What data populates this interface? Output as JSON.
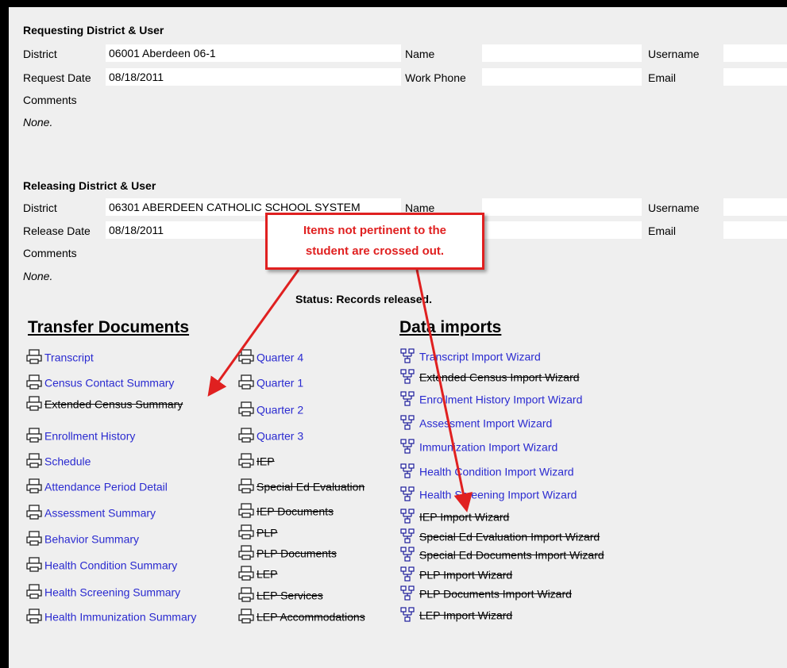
{
  "requesting": {
    "title": "Requesting District & User",
    "district_label": "District",
    "district_value": "06001 Aberdeen 06-1",
    "name_label": "Name",
    "name_value": "",
    "username_label": "Username",
    "username_value": "",
    "request_date_label": "Request Date",
    "request_date_value": "08/18/2011",
    "work_phone_label": "Work Phone",
    "work_phone_value": "",
    "email_label": "Email",
    "email_value": "",
    "comments_label": "Comments",
    "comments_value": "None."
  },
  "releasing": {
    "title": "Releasing District & User",
    "district_label": "District",
    "district_value": "06301 ABERDEEN CATHOLIC SCHOOL SYSTEM",
    "name_label": "Name",
    "name_value": "",
    "username_label": "Username",
    "username_value": "",
    "release_date_label": "Release Date",
    "release_date_value": "08/18/2011",
    "email_label": "Email",
    "email_value": "",
    "comments_label": "Comments",
    "comments_value": "None."
  },
  "status": "Status: Records released.",
  "callout": {
    "line1": "Items not pertinent to the",
    "line2": "student are crossed out.",
    "color": "#e02020"
  },
  "transfer_documents": {
    "title": "Transfer Documents",
    "col1": [
      {
        "label": "Transcript",
        "crossed": false,
        "icon": "printer-icon"
      },
      {
        "label": "Census Contact Summary",
        "crossed": false,
        "icon": "printer-icon"
      },
      {
        "label": "Extended Census Summary",
        "crossed": true,
        "icon": "printer-icon"
      },
      {
        "label": "Enrollment History",
        "crossed": false,
        "icon": "printer-icon"
      },
      {
        "label": "Schedule",
        "crossed": false,
        "icon": "printer-icon"
      },
      {
        "label": "Attendance Period Detail",
        "crossed": false,
        "icon": "printer-icon"
      },
      {
        "label": "Assessment Summary",
        "crossed": false,
        "icon": "printer-icon"
      },
      {
        "label": "Behavior Summary",
        "crossed": false,
        "icon": "printer-icon"
      },
      {
        "label": "Health Condition Summary",
        "crossed": false,
        "icon": "printer-icon"
      },
      {
        "label": "Health Screening Summary",
        "crossed": false,
        "icon": "printer-icon"
      },
      {
        "label": "Health Immunization Summary",
        "crossed": false,
        "icon": "printer-icon"
      }
    ],
    "col2": [
      {
        "label": "Quarter 4",
        "crossed": false,
        "icon": "printer-icon"
      },
      {
        "label": "Quarter 1",
        "crossed": false,
        "icon": "printer-icon"
      },
      {
        "label": "Quarter 2",
        "crossed": false,
        "icon": "printer-icon"
      },
      {
        "label": "Quarter 3",
        "crossed": false,
        "icon": "printer-icon"
      },
      {
        "label": "IEP",
        "crossed": true,
        "icon": "printer-icon"
      },
      {
        "label": "Special Ed Evaluation",
        "crossed": true,
        "icon": "printer-icon"
      },
      {
        "label": "IEP Documents",
        "crossed": true,
        "icon": "printer-icon"
      },
      {
        "label": "PLP",
        "crossed": true,
        "icon": "printer-icon"
      },
      {
        "label": "PLP Documents",
        "crossed": true,
        "icon": "printer-icon"
      },
      {
        "label": "LEP",
        "crossed": true,
        "icon": "printer-icon"
      },
      {
        "label": "LEP Services",
        "crossed": true,
        "icon": "printer-icon"
      },
      {
        "label": "LEP Accommodations",
        "crossed": true,
        "icon": "printer-icon"
      }
    ]
  },
  "data_imports": {
    "title": "Data imports",
    "items": [
      {
        "label": "Transcript Import Wizard",
        "crossed": false,
        "icon": "wizard-icon"
      },
      {
        "label": "Extended Census Import Wizard",
        "crossed": true,
        "icon": "wizard-icon"
      },
      {
        "label": "Enrollment History Import Wizard",
        "crossed": false,
        "icon": "wizard-icon"
      },
      {
        "label": "Assessment Import Wizard",
        "crossed": false,
        "icon": "wizard-icon"
      },
      {
        "label": "Immunization Import Wizard",
        "crossed": false,
        "icon": "wizard-icon"
      },
      {
        "label": "Health Condition Import Wizard",
        "crossed": false,
        "icon": "wizard-icon"
      },
      {
        "label": "Health Screening Import Wizard",
        "crossed": false,
        "icon": "wizard-icon"
      },
      {
        "label": "IEP Import Wizard",
        "crossed": true,
        "icon": "wizard-icon"
      },
      {
        "label": "Special Ed Evaluation Import Wizard",
        "crossed": true,
        "icon": "wizard-icon"
      },
      {
        "label": "Special Ed Documents Import Wizard",
        "crossed": true,
        "icon": "wizard-icon"
      },
      {
        "label": "PLP Import Wizard",
        "crossed": true,
        "icon": "wizard-icon"
      },
      {
        "label": "PLP Documents Import Wizard",
        "crossed": true,
        "icon": "wizard-icon"
      },
      {
        "label": "LEP Import Wizard",
        "crossed": true,
        "icon": "wizard-icon"
      }
    ]
  }
}
